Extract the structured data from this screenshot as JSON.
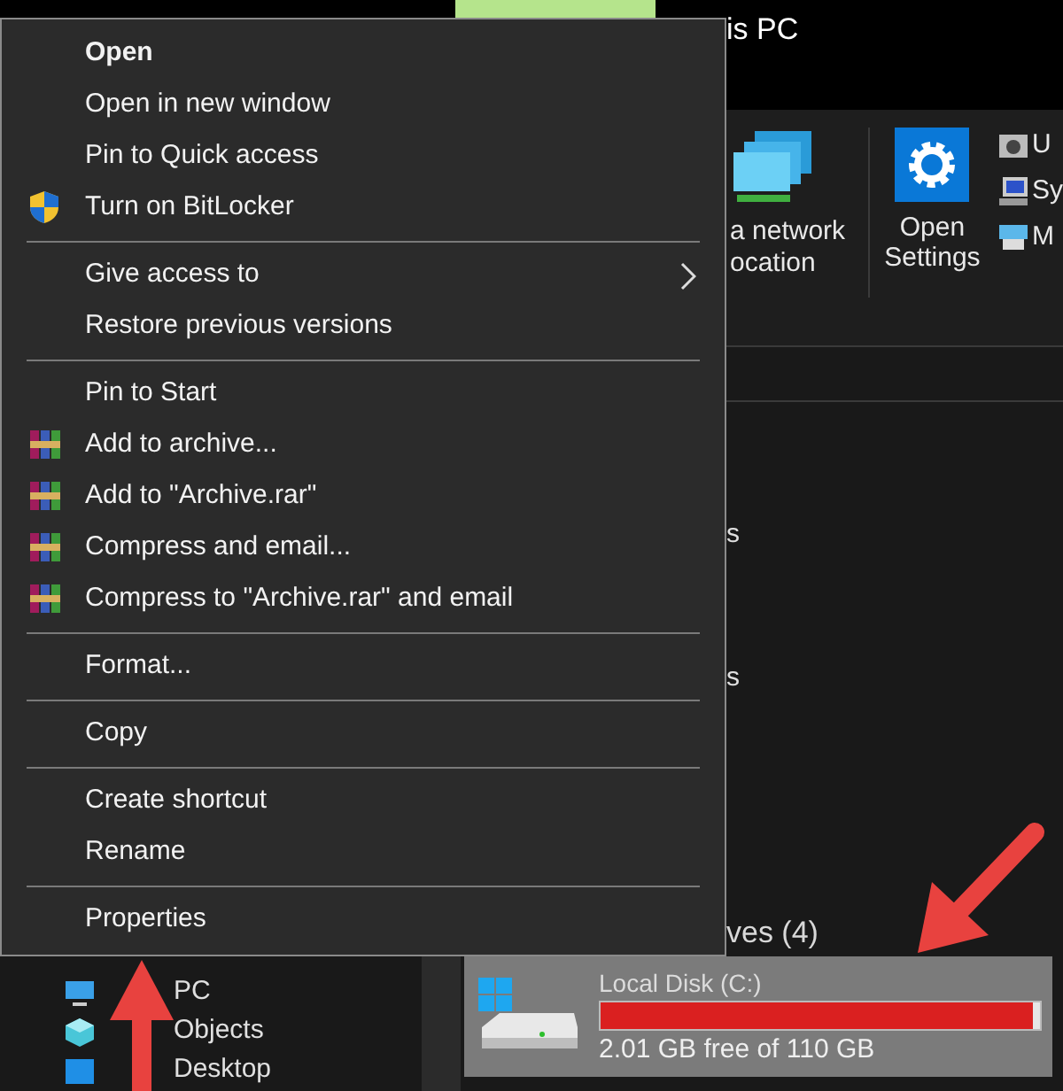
{
  "window": {
    "title": "is PC"
  },
  "ribbon": {
    "network": [
      "a network",
      "ocation"
    ],
    "settings": [
      "Open",
      "Settings"
    ],
    "small_items": [
      {
        "label": "U",
        "kind": "camera"
      },
      {
        "label": "Sy",
        "kind": "system"
      },
      {
        "label": "M",
        "kind": "manage"
      }
    ]
  },
  "nav": {
    "items": [
      {
        "label": "PC",
        "kind": "pc"
      },
      {
        "label": "Objects",
        "kind": "cube"
      },
      {
        "label": "Desktop",
        "kind": "desktop"
      }
    ]
  },
  "content": {
    "labels": [
      "s",
      "s"
    ],
    "group_header": "ves (4)",
    "drive": {
      "name": "Local Disk (C:)",
      "level": 0.985,
      "free": "2.01 GB free of 110 GB"
    }
  },
  "menu": {
    "groups": [
      [
        {
          "label": "Open",
          "kind": "plain",
          "default": true,
          "submenu": false
        },
        {
          "label": "Open in new window",
          "kind": "plain",
          "default": false,
          "submenu": false
        },
        {
          "label": "Pin to Quick access",
          "kind": "plain",
          "default": false,
          "submenu": false
        },
        {
          "label": "Turn on BitLocker",
          "kind": "shield",
          "default": false,
          "submenu": false
        }
      ],
      [
        {
          "label": "Give access to",
          "kind": "plain",
          "default": false,
          "submenu": true
        },
        {
          "label": "Restore previous versions",
          "kind": "plain",
          "default": false,
          "submenu": false
        }
      ],
      [
        {
          "label": "Pin to Start",
          "kind": "plain",
          "default": false,
          "submenu": false
        },
        {
          "label": "Add to archive...",
          "kind": "archive",
          "default": false,
          "submenu": false
        },
        {
          "label": "Add to \"Archive.rar\"",
          "kind": "archive",
          "default": false,
          "submenu": false
        },
        {
          "label": "Compress and email...",
          "kind": "archive",
          "default": false,
          "submenu": false
        },
        {
          "label": "Compress to \"Archive.rar\" and email",
          "kind": "archive",
          "default": false,
          "submenu": false
        }
      ],
      [
        {
          "label": "Format...",
          "kind": "plain",
          "default": false,
          "submenu": false
        }
      ],
      [
        {
          "label": "Copy",
          "kind": "plain",
          "default": false,
          "submenu": false
        }
      ],
      [
        {
          "label": "Create shortcut",
          "kind": "plain",
          "default": false,
          "submenu": false
        },
        {
          "label": "Rename",
          "kind": "plain",
          "default": false,
          "submenu": false
        }
      ],
      [
        {
          "label": "Properties",
          "kind": "plain",
          "default": false,
          "submenu": false
        }
      ]
    ]
  }
}
